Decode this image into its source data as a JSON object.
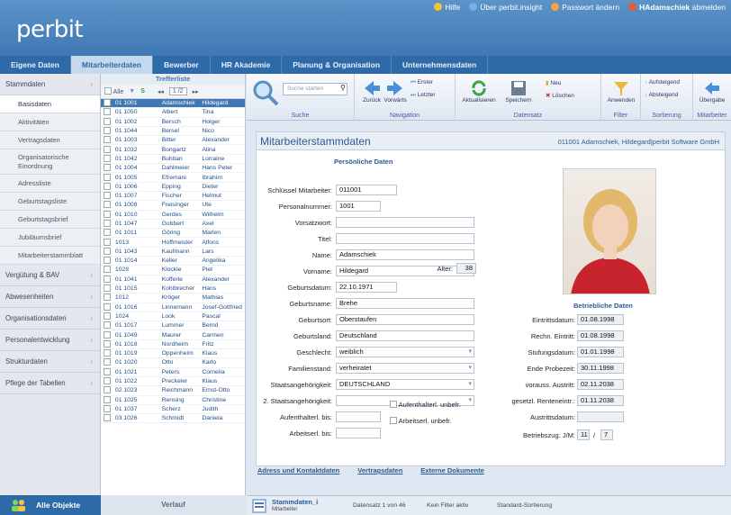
{
  "header": {
    "logo": "perbit",
    "links": [
      "Hilfe",
      "Über perbit.insight",
      "Passwort ändern",
      "HAdamschiek",
      "abmelden"
    ]
  },
  "nav": {
    "tabs": [
      "Eigene Daten",
      "Mitarbeiterdaten",
      "Bewerber",
      "HR Akademie",
      "Planung & Organisation",
      "Unternehmensdaten"
    ]
  },
  "sidebar": {
    "groups": [
      "Stammdaten",
      "Vergütung & BAV",
      "Abwesenheiten",
      "Organisationsdaten",
      "Personalentwicklung",
      "Strukturdaten",
      "Pflege der Tabellen"
    ],
    "items": [
      "Basisdaten",
      "Aktivitäten",
      "Vertragsdaten",
      "Organisatorische Einordnung",
      "Adressliste",
      "Geburtstagsliste",
      "Geburtstagsbrief",
      "Jubiläumsbrief",
      "Mitarbeiterstammblatt"
    ],
    "bottom": "Alle Objekte"
  },
  "list": {
    "title": "Trefferliste",
    "all_label": "Alle",
    "pager": "1 /2",
    "footer": "Verlauf",
    "rows": [
      [
        "01",
        "1001",
        "Adamschiek",
        "Hildegard"
      ],
      [
        "01",
        "1050",
        "Albert",
        "Tina"
      ],
      [
        "01",
        "1002",
        "Bersch",
        "Holger"
      ],
      [
        "01",
        "1044",
        "Bersel",
        "Nico"
      ],
      [
        "01",
        "1003",
        "Bitter",
        "Alexander"
      ],
      [
        "01",
        "1032",
        "Bongartz",
        "Alina"
      ],
      [
        "01",
        "1042",
        "Buhltan",
        "Lorraine"
      ],
      [
        "01",
        "1004",
        "Dahlmeier",
        "Hans Peter"
      ],
      [
        "01",
        "1005",
        "Efremani",
        "Ibrahim"
      ],
      [
        "01",
        "1006",
        "Epping",
        "Dieter"
      ],
      [
        "01",
        "1007",
        "Fischer",
        "Helmut"
      ],
      [
        "01",
        "1008",
        "Freisinger",
        "Ute"
      ],
      [
        "01",
        "1010",
        "Gerdes",
        "Wilhelm"
      ],
      [
        "01",
        "1047",
        "Gobbert",
        "Axel"
      ],
      [
        "01",
        "1011",
        "Göring",
        "Marlen"
      ],
      [
        "",
        "1013",
        "Hoffmeister",
        "Alfons"
      ],
      [
        "01",
        "1043",
        "Kaufmann",
        "Lars"
      ],
      [
        "01",
        "1014",
        "Keller",
        "Angelika"
      ],
      [
        "",
        "1028",
        "Klockie",
        "Piet"
      ],
      [
        "01",
        "1041",
        "Kofferle",
        "Alexander"
      ],
      [
        "01",
        "1015",
        "Kohlbrecher",
        "Hans"
      ],
      [
        "",
        "1012",
        "Kröger",
        "Mathias"
      ],
      [
        "01",
        "1016",
        "Linnemann",
        "Josef-Gottfried"
      ],
      [
        "",
        "1024",
        "Look",
        "Pascal"
      ],
      [
        "01",
        "1017",
        "Lummer",
        "Bernd"
      ],
      [
        "01",
        "1049",
        "Maurer",
        "Carmen"
      ],
      [
        "01",
        "1018",
        "Nordheim",
        "Fritz"
      ],
      [
        "01",
        "1019",
        "Oppenheim",
        "Klaus"
      ],
      [
        "01",
        "1020",
        "Otto",
        "Karlo"
      ],
      [
        "01",
        "1021",
        "Peters",
        "Cornelia"
      ],
      [
        "01",
        "1022",
        "Preckeler",
        "Klaus"
      ],
      [
        "02",
        "1023",
        "Reichmann",
        "Ernst-Otto"
      ],
      [
        "01",
        "1025",
        "Rensing",
        "Christine"
      ],
      [
        "01",
        "1037",
        "Scherz",
        "Judith"
      ],
      [
        "03",
        "1026",
        "Schmidt",
        "Daniela"
      ]
    ]
  },
  "ribbon": {
    "search_placeholder": "Suche starten",
    "search_label": "Suche",
    "nav_back": "Zurück",
    "nav_forward": "Vorwärts",
    "nav_first": "Erster",
    "nav_last": "Letzter",
    "nav_label": "Navigation",
    "refresh": "Aktualisieren",
    "save": "Speichern",
    "new": "Neu",
    "delete": "Löschen",
    "dataset_label": "Datensatz",
    "apply": "Anwenden",
    "filter_label": "Filter",
    "asc": "Aufsteigend",
    "desc": "Absteigend",
    "sort_label": "Sortierung",
    "transfer": "Übergabe",
    "employee_label": "Mitarbeiter"
  },
  "form": {
    "title": "Mitarbeiterstammdaten",
    "subtitle": "011001 Adamschiek, Hildegard|perbit Software GmbH",
    "section_personal": "Persönliche Daten",
    "section_business": "Betriebliche Daten",
    "fields": [
      {
        "label": "Schlüssel Mitarbeiter:",
        "value": "011001"
      },
      {
        "label": "Personalnummer:",
        "value": "1001"
      },
      {
        "label": "Vorsatzwort:",
        "value": ""
      },
      {
        "label": "Titel:",
        "value": ""
      },
      {
        "label": "Name:",
        "value": "Adamschiek"
      },
      {
        "label": "Vorname:",
        "value": "Hildegard"
      },
      {
        "label": "Geburtsdatum:",
        "value": "22.10.1971"
      },
      {
        "label": "Geburtsname:",
        "value": "Brehe"
      },
      {
        "label": "Geburtsort:",
        "value": "Oberstaufen"
      },
      {
        "label": "Geburtsland:",
        "value": "Deutschland"
      },
      {
        "label": "Geschlecht:",
        "value": "weiblich"
      },
      {
        "label": "Familienstand:",
        "value": "verheiratet"
      },
      {
        "label": "Staatsangehörigkeit:",
        "value": "DEUTSCHLAND"
      },
      {
        "label": "2. Staatsangehörigkeit:",
        "value": ""
      },
      {
        "label": "Aufenthalterl. bis:",
        "value": ""
      },
      {
        "label": "Arbeitserl. bis:",
        "value": ""
      }
    ],
    "age_label": "Alter:",
    "age_value": "38",
    "check1": "Aufenthalterl. unbefr.",
    "check2": "Arbeitserl. unbefr.",
    "business": [
      {
        "label": "Eintrittsdatum:",
        "value": "01.08.1998"
      },
      {
        "label": "Rechn. Eintritt:",
        "value": "01.08.1998"
      },
      {
        "label": "Stufungsdatum:",
        "value": "01.01.1998"
      },
      {
        "label": "Ende Probezeit:",
        "value": "30.11.1998"
      },
      {
        "label": "vorauss. Austritt:",
        "value": "02.11.2038"
      },
      {
        "label": "gesetzl. Renteneintr.:",
        "value": "01.11.2038"
      },
      {
        "label": "Austrittsdatum:",
        "value": ""
      }
    ],
    "bz_label": "Betriebszug. J/M:",
    "bz_years": "11",
    "bz_sep": "/",
    "bz_months": "7",
    "bottom_tabs": [
      "Adress und Kontaktdaten",
      "Vertragsdaten",
      "Externe Dokumente"
    ]
  },
  "status": {
    "module": "Stammdaten_i",
    "module_sub": "Mitarbeiter",
    "record": "Datensatz 1 von 46",
    "filter": "Kein Filter aktiv",
    "sort": "Standard-Sortierung"
  }
}
